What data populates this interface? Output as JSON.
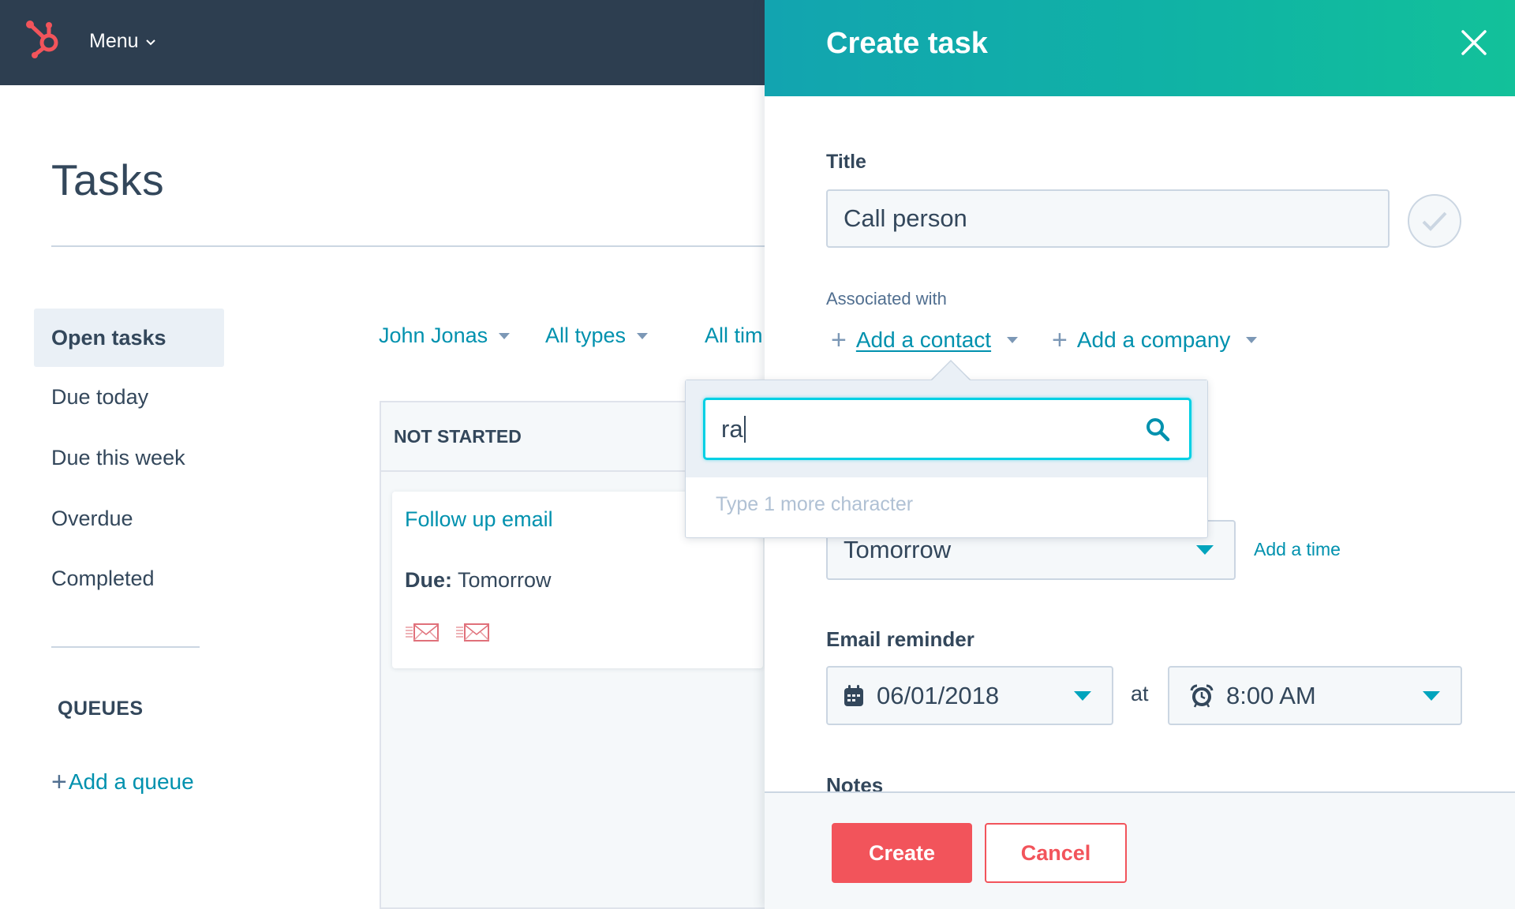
{
  "topnav": {
    "logo": "hubspot-sprocket-logo",
    "menu_label": "Menu"
  },
  "page": {
    "title": "Tasks"
  },
  "sidebar": {
    "items": [
      {
        "label": "Open tasks",
        "active": true
      },
      {
        "label": "Due today",
        "active": false
      },
      {
        "label": "Due this week",
        "active": false
      },
      {
        "label": "Overdue",
        "active": false
      },
      {
        "label": "Completed",
        "active": false
      }
    ],
    "queues_heading": "QUEUES",
    "add_queue_label": "Add a queue"
  },
  "filters": [
    {
      "label": "John Jonas"
    },
    {
      "label": "All types"
    },
    {
      "label": "All tim"
    }
  ],
  "board": {
    "column_header": "NOT STARTED",
    "card": {
      "title": "Follow up email",
      "due_label": "Due:",
      "due_value": "Tomorrow",
      "icons": [
        "email-icon",
        "email-icon"
      ]
    }
  },
  "panel": {
    "title": "Create task",
    "title_label": "Title",
    "title_value": "Call person",
    "associated_label": "Associated with",
    "add_contact_label": "Add a contact",
    "add_company_label": "Add a company",
    "due_value": "Tomorrow",
    "add_time_label": "Add a time",
    "email_reminder_label": "Email reminder",
    "reminder_date": "06/01/2018",
    "at_label": "at",
    "reminder_time": "8:00 AM",
    "notes_label": "Notes",
    "create_label": "Create",
    "cancel_label": "Cancel"
  },
  "contact_search": {
    "value": "ra",
    "hint": "Type 1 more character"
  },
  "colors": {
    "nav_bg": "#2d3e50",
    "accent_teal": "#0091ae",
    "header_gradient_start": "#12a4b0",
    "header_gradient_end": "#12c19a",
    "primary_button": "#f2545b",
    "focus_ring": "#00d0e4"
  }
}
